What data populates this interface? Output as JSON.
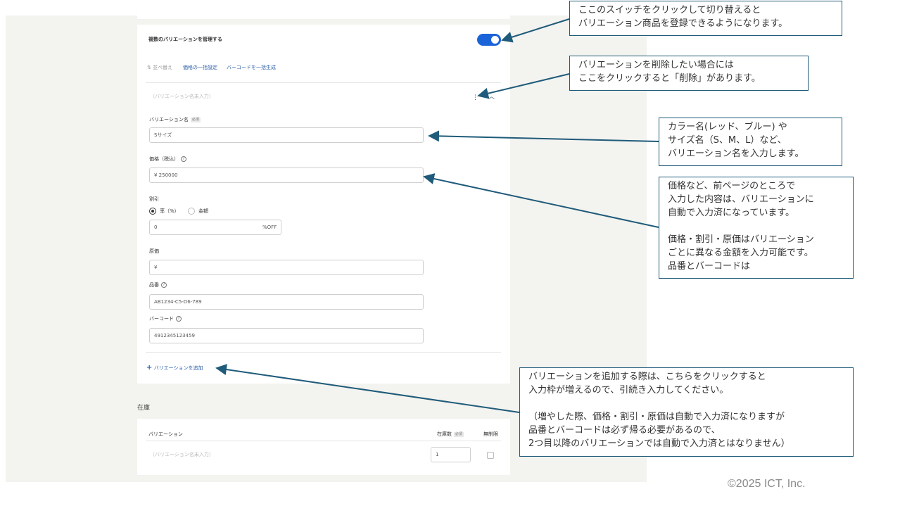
{
  "variations": {
    "title": "複数のバリエーションを管理する",
    "toggle_on": true,
    "toolbar": {
      "sort_label": "並べ替え",
      "bulk_price_label": "価格の一括設定",
      "bulk_barcode_label": "バーコードを一括生成"
    },
    "item_header": "（バリエーション名未入力）",
    "name_label": "バリエーション名",
    "required_badge": "必須",
    "name_placeholder": "Sサイズ",
    "price_label": "価格（税込）",
    "price_value": "¥  250000",
    "discount_label": "割引",
    "discount_rate_label": "率（%）",
    "discount_amount_label": "金額",
    "discount_value": "0",
    "discount_suffix": "%OFF",
    "cost_label": "原価",
    "cost_value": "¥",
    "sku_label": "品番",
    "sku_placeholder": "AB1234-C5-D6-789",
    "barcode_label": "バーコード",
    "barcode_placeholder": "4912345123459",
    "add_variation_label": "バリエーションを追加",
    "add_icon": "plus-icon"
  },
  "stock": {
    "section_title": "在庫",
    "col_variation": "バリエーション",
    "col_stock": "在庫数",
    "col_unlimited": "無制限",
    "required_badge": "必須",
    "row_name": "（バリエーション名未入力）",
    "row_stock_value": "1"
  },
  "callouts": {
    "toggle_note": "ここのスイッチをクリックして切り替えると\nバリエーション商品を登録できるようになります。",
    "delete_note": "バリエーションを削除したい場合には\nここをクリックすると「削除」があります。",
    "name_note": "カラー名(レッド、ブルー) や\nサイズ名（S、M、L）など、\nバリエーション名を入力します。",
    "price_note": "価格など、前ページのところで\n入力した内容は、バリエーションに\n自動で入力済になっています。\n\n価格・割引・原価はバリエーション\nごとに異なる金額を入力可能です。\n品番とバーコードは",
    "add_note": "バリエーションを追加する際は、こちらをクリックすると\n入力枠が増えるので、引続き入力してください。\n\n（増やした際、価格・割引・原価は自動で入力済になりますが\n品番とバーコードは必ず帰る必要があるので、\n2つ目以降のバリエーションでは自動で入力済とはなりません）"
  },
  "colors": {
    "accent": "#1a63d8",
    "callout_border": "#1f5b7a",
    "arrow": "#1f5b7a"
  },
  "footer": {
    "copyright": "©2025 ICT, Inc."
  }
}
